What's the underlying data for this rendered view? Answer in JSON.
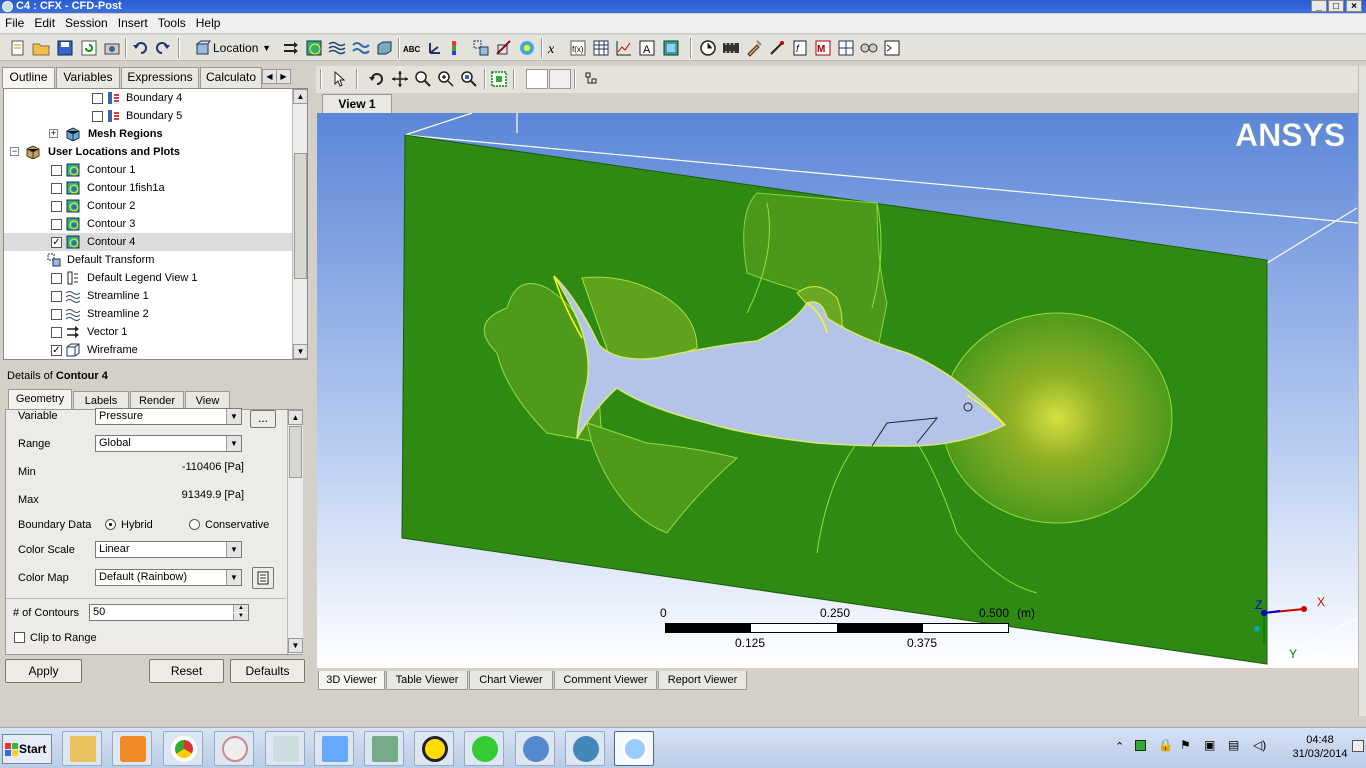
{
  "window": {
    "title": "C4 : CFX - CFD-Post"
  },
  "menu": [
    "File",
    "Edit",
    "Session",
    "Insert",
    "Tools",
    "Help"
  ],
  "toolbar": {
    "location_label": "Location"
  },
  "left_tabs": [
    "Outline",
    "Variables",
    "Expressions",
    "Calculato"
  ],
  "tree": {
    "items": [
      {
        "label": "Boundary 4",
        "checked": false
      },
      {
        "label": "Boundary 5",
        "checked": false
      },
      {
        "label": "Mesh Regions",
        "checked": null
      },
      {
        "label": "User Locations and Plots",
        "checked": null
      },
      {
        "label": "Contour 1",
        "checked": false
      },
      {
        "label": "Contour 1fish1a",
        "checked": false
      },
      {
        "label": "Contour 2",
        "checked": false
      },
      {
        "label": "Contour 3",
        "checked": false
      },
      {
        "label": "Contour 4",
        "checked": true
      },
      {
        "label": "Default Transform",
        "checked": null
      },
      {
        "label": "Default Legend View 1",
        "checked": false
      },
      {
        "label": "Streamline 1",
        "checked": false
      },
      {
        "label": "Streamline 2",
        "checked": false
      },
      {
        "label": "Vector 1",
        "checked": false
      },
      {
        "label": "Wireframe",
        "checked": true
      }
    ]
  },
  "details": {
    "header_prefix": "Details of ",
    "header_object": "Contour 4",
    "tabs": [
      "Geometry",
      "Labels",
      "Render",
      "View"
    ],
    "variable_label": "Variable",
    "variable_value": "Pressure",
    "variable_more": "...",
    "range_label": "Range",
    "range_value": "Global",
    "min_label": "Min",
    "min_value": "-110406 [Pa]",
    "max_label": "Max",
    "max_value": "91349.9 [Pa]",
    "boundary_label": "Boundary Data",
    "boundary_opt1": "Hybrid",
    "boundary_opt2": "Conservative",
    "colorscale_label": "Color Scale",
    "colorscale_value": "Linear",
    "colormap_label": "Color Map",
    "colormap_value": "Default (Rainbow)",
    "contours_label": "# of Contours",
    "contours_value": "50",
    "clip_label": "Clip to Range",
    "apply": "Apply",
    "reset": "Reset",
    "defaults": "Defaults"
  },
  "view": {
    "tab": "View 1",
    "brand": "ANSYS",
    "scale": {
      "t0": "0",
      "t250": "0.250",
      "t500": "0.500",
      "unit": "(m)",
      "t125": "0.125",
      "t375": "0.375"
    },
    "axes": {
      "z": "Z",
      "x": "X",
      "y": "Y"
    }
  },
  "bottom_tabs": [
    "3D Viewer",
    "Table Viewer",
    "Chart Viewer",
    "Comment Viewer",
    "Report Viewer"
  ],
  "taskbar": {
    "start": "Start",
    "time": "04:48",
    "date": "31/03/2014"
  },
  "colors": {
    "domain_green": "#2f8a14",
    "fish": "#b3c3ea",
    "sky_top": "#5b86d8",
    "sky_bottom": "#ffffff"
  }
}
